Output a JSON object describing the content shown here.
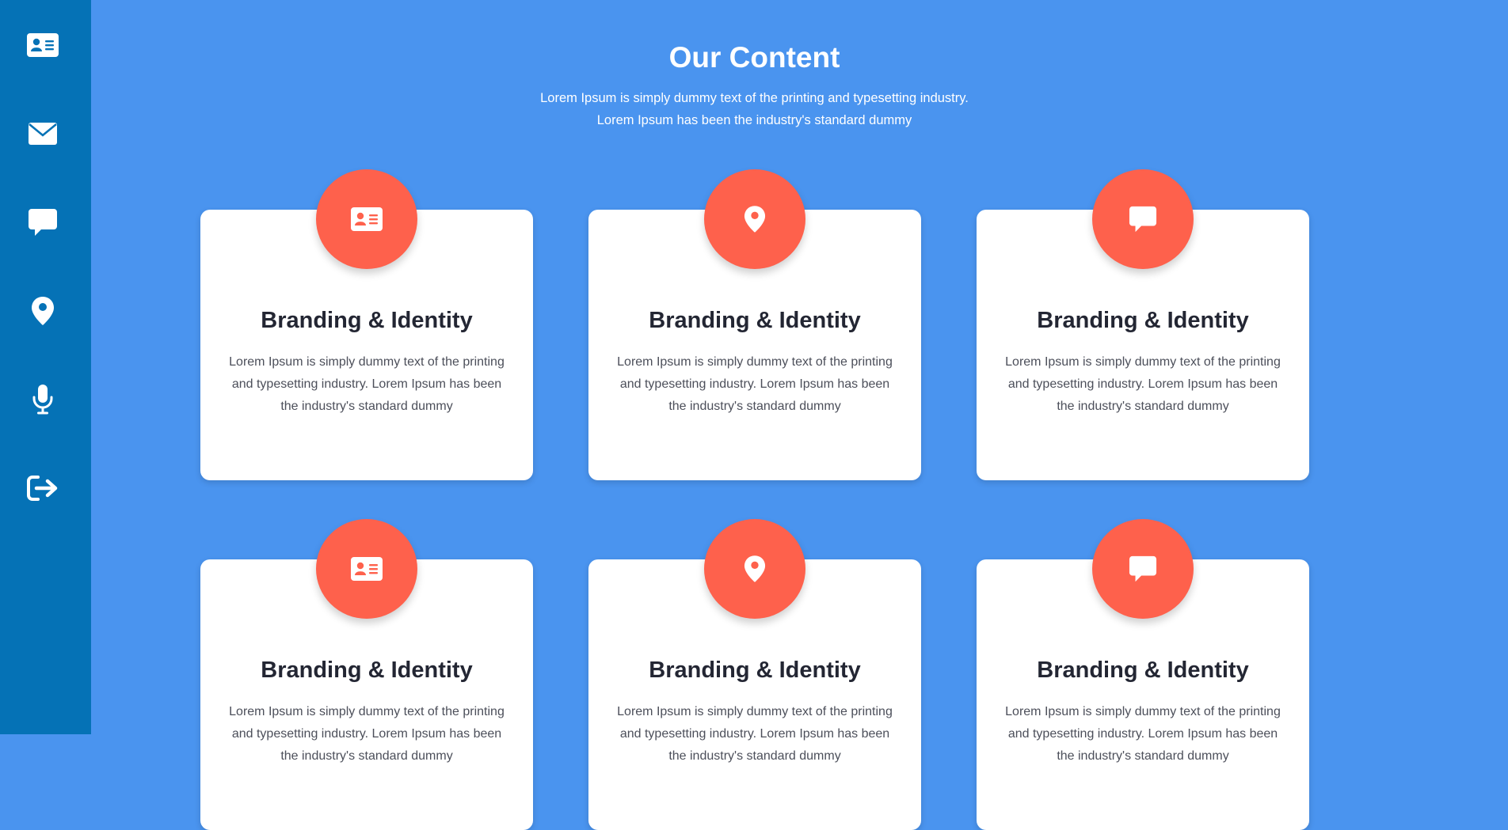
{
  "sidebar": {
    "items": [
      {
        "icon": "id-card-icon"
      },
      {
        "icon": "envelope-icon"
      },
      {
        "icon": "chat-bubble-icon"
      },
      {
        "icon": "map-pin-icon"
      },
      {
        "icon": "microphone-icon"
      },
      {
        "icon": "sign-out-icon"
      }
    ]
  },
  "header": {
    "title": "Our Content",
    "subtitle_line1": "Lorem Ipsum is simply dummy text of the printing and typesetting industry.",
    "subtitle_line2": "Lorem Ipsum has been the industry's standard dummy"
  },
  "cards": [
    {
      "icon": "id-card-icon",
      "title": "Branding & Identity",
      "text": "Lorem Ipsum is simply dummy text of the printing and typesetting industry. Lorem Ipsum has been the industry's standard dummy"
    },
    {
      "icon": "map-pin-icon",
      "title": "Branding & Identity",
      "text": "Lorem Ipsum is simply dummy text of the printing and typesetting industry. Lorem Ipsum has been the industry's standard dummy"
    },
    {
      "icon": "chat-bubble-icon",
      "title": "Branding & Identity",
      "text": "Lorem Ipsum is simply dummy text of the printing and typesetting industry. Lorem Ipsum has been the industry's standard dummy"
    },
    {
      "icon": "id-card-icon",
      "title": "Branding & Identity",
      "text": "Lorem Ipsum is simply dummy text of the printing and typesetting industry. Lorem Ipsum has been the industry's standard dummy"
    },
    {
      "icon": "map-pin-icon",
      "title": "Branding & Identity",
      "text": "Lorem Ipsum is simply dummy text of the printing and typesetting industry. Lorem Ipsum has been the industry's standard dummy"
    },
    {
      "icon": "chat-bubble-icon",
      "title": "Branding & Identity",
      "text": "Lorem Ipsum is simply dummy text of the printing and typesetting industry. Lorem Ipsum has been the industry's standard dummy"
    }
  ],
  "colors": {
    "background": "#4a94ef",
    "sidebar": "#0572b6",
    "accent": "#fe614c",
    "card": "#ffffff",
    "title_text": "#232633",
    "body_text": "#4c4f5a"
  }
}
